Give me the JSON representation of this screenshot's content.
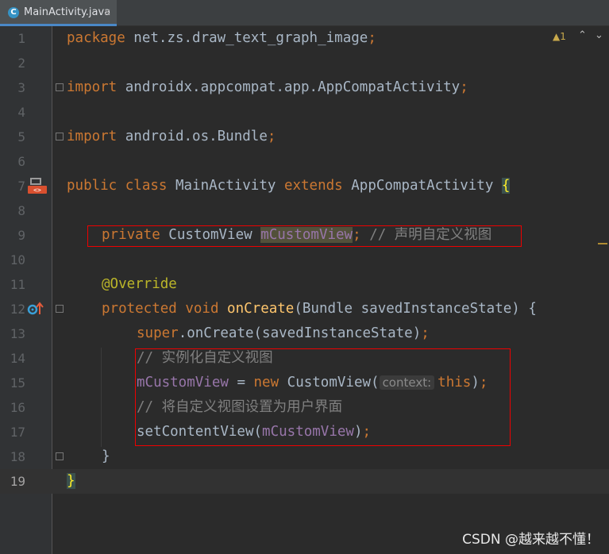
{
  "tab": {
    "icon_letter": "C",
    "label": "MainActivity.java",
    "close": "×"
  },
  "inspection": {
    "count": "1",
    "up": "^",
    "down": "v"
  },
  "lines": [
    "1",
    "2",
    "3",
    "4",
    "5",
    "6",
    "7",
    "8",
    "9",
    "10",
    "11",
    "12",
    "13",
    "14",
    "15",
    "16",
    "17",
    "18",
    "19"
  ],
  "code": {
    "l1": {
      "kw": "package",
      "rest": " net.zs.draw_text_graph_image",
      "semi": ";"
    },
    "l3": {
      "kw": "import",
      "rest": " androidx.appcompat.app.AppCompatActivity",
      "semi": ";"
    },
    "l5": {
      "kw": "import",
      "rest": " android.os.Bundle",
      "semi": ";"
    },
    "l7": {
      "kw1": "public class",
      "name": " MainActivity ",
      "kw2": "extends",
      "rest": " AppCompatActivity ",
      "brace": "{"
    },
    "l9": {
      "kw": "private",
      "type": " CustomView ",
      "field": "mCustomView",
      "semi": ";",
      "comment": " // 声明自定义视图"
    },
    "l11": {
      "ann": "@Override"
    },
    "l12": {
      "kw": "protected void",
      "method": " onCreate",
      "rest": "(Bundle savedInstanceState) {"
    },
    "l13": {
      "kw": "super",
      "rest": ".onCreate(savedInstanceState)",
      "semi": ";"
    },
    "l14": {
      "comment": "// 实例化自定义视图"
    },
    "l15": {
      "field": "mCustomView",
      "op": " = ",
      "kw": "new",
      "rest": " CustomView(",
      "hint": "context:",
      "kw2": "this",
      "close": ")",
      "semi": ";"
    },
    "l16": {
      "comment": "// 将自定义视图设置为用户界面"
    },
    "l17": {
      "rest": "setContentView(",
      "field": "mCustomView",
      "close": ")",
      "semi": ";"
    },
    "l18": {
      "rest": "}"
    },
    "l19": {
      "brace": "}"
    }
  },
  "watermark": "CSDN @越来越不懂！"
}
